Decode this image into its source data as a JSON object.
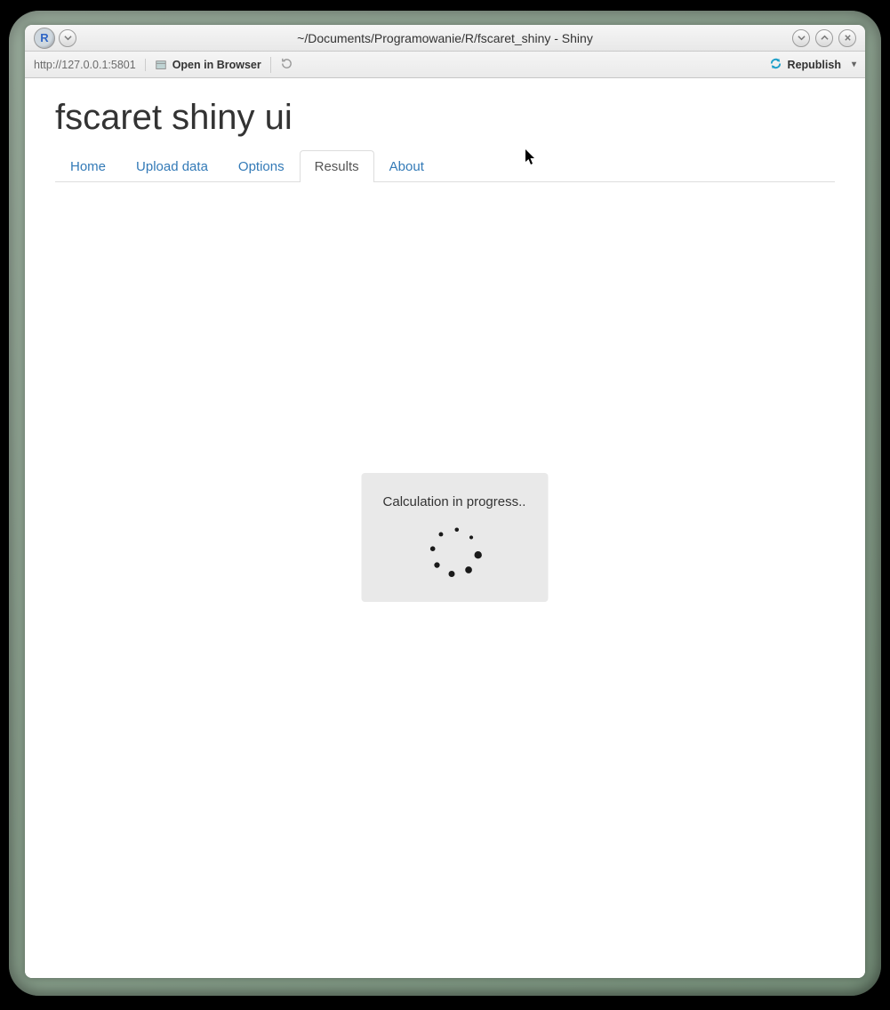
{
  "window": {
    "title": "~/Documents/Programowanie/R/fscaret_shiny - Shiny"
  },
  "toolbar": {
    "url": "http://127.0.0.1:5801",
    "open_in_browser": "Open in Browser",
    "republish": "Republish"
  },
  "page": {
    "title": "fscaret shiny ui"
  },
  "tabs": [
    {
      "label": "Home",
      "active": false
    },
    {
      "label": "Upload data",
      "active": false
    },
    {
      "label": "Options",
      "active": false
    },
    {
      "label": "Results",
      "active": true
    },
    {
      "label": "About",
      "active": false
    }
  ],
  "progress": {
    "message": "Calculation in progress.."
  }
}
